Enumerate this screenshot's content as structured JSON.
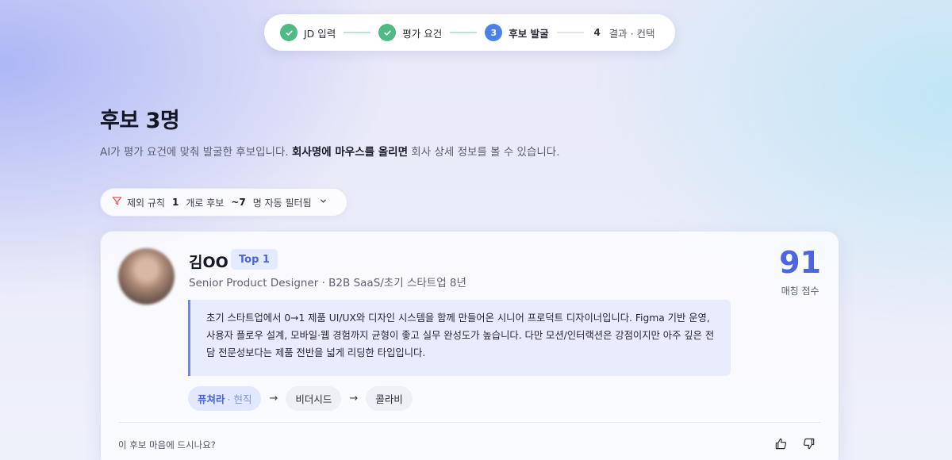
{
  "stepper": {
    "steps": [
      {
        "number": "",
        "label": "JD 입력",
        "state": "done",
        "icon": "check-icon"
      },
      {
        "number": "",
        "label": "평가 요건",
        "state": "done",
        "icon": "check-icon"
      },
      {
        "number": "3",
        "label": "후보 발굴",
        "state": "current"
      },
      {
        "number": "4",
        "label": "결과 · 컨택",
        "state": "pending"
      }
    ]
  },
  "header": {
    "title": "후보 3명",
    "subtitle_before": "AI가 평가 요건에 맞춰 발굴한 후보입니다. ",
    "subtitle_bold": "회사명에 마우스를 올리면",
    "subtitle_after": " 회사 상세 정보를 볼 수 있습니다."
  },
  "filter": {
    "icon": "filter-icon",
    "text1": "제외 규칙",
    "rule_count": "1",
    "text2": "개로 후보",
    "filtered_count": "~7",
    "text3": "명 자동 필터됨",
    "chevron": "⌄"
  },
  "candidate": {
    "name": "김OO",
    "badge": "Top 1",
    "role": "Senior Product Designer · B2B SaaS/초기 스타트업 8년",
    "score": "91",
    "score_label": "매칭 점수",
    "summary": "초기 스타트업에서 0→1 제품 UI/UX와 디자인 시스템을 함께 만들어온 시니어 프로덕트 디자이너입니다. Figma 기반 운영, 사용자 플로우 설계, 모바일·웹 경험까지 균형이 좋고 실무 완성도가 높습니다. 다만 모션/인터랙션은 강점이지만 아주 깊은 전담 전문성보다는 제품 전반을 넓게 리딩한 타입입니다.",
    "career": {
      "current_company": "퓨쳐라",
      "current_tag": "· 현직",
      "past": [
        "비더시드",
        "콜라비"
      ],
      "arrow": "→"
    },
    "feedback_question": "이 후보 마음에 드시나요?"
  },
  "colors": {
    "accent": "#4d66e0",
    "done_green": "#4fba84",
    "current_blue": "#4c82e8",
    "filter_red": "#e05a5a"
  }
}
